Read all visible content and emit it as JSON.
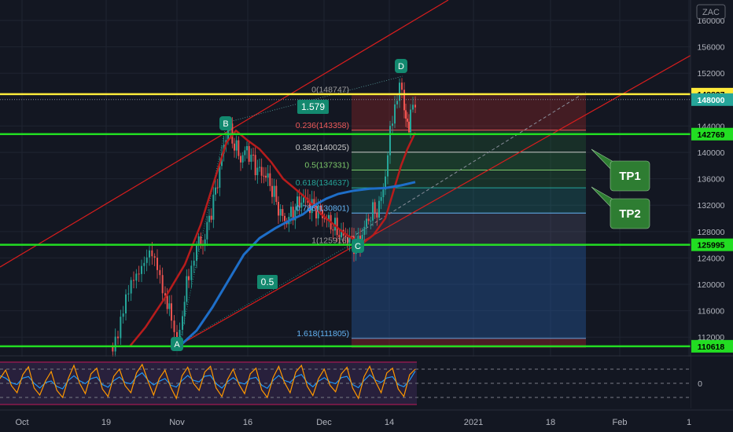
{
  "symbol": "ZAC",
  "colors": {
    "background": "#131722",
    "grid": "#1f2431",
    "axis_text": "#b2b5be",
    "candle_up": "#26a69a",
    "candle_down": "#ef5350",
    "ma_fast": "#b71c1c",
    "ma_slow": "#1e6ec8",
    "channel": "#d81d1d",
    "level_yellow": "#ffeb3b",
    "level_green": "#22dd22",
    "wave_label": "#13896f",
    "tp_box": "#2e7d32"
  },
  "chart_data": {
    "type": "candlestick",
    "x_ticks": [
      "Oct",
      "19",
      "Nov",
      "16",
      "Dec",
      "14",
      "2021",
      "18",
      "Feb",
      "1"
    ],
    "y_ticks": [
      112000,
      116000,
      120000,
      124000,
      128000,
      132000,
      136000,
      140000,
      144000,
      152000,
      156000,
      160000
    ],
    "ylim": [
      110000,
      162000
    ],
    "price_tags": [
      {
        "value": 148827,
        "label": "148827",
        "style": "yellow"
      },
      {
        "value": 148000,
        "label": "148000",
        "style": "teal"
      },
      {
        "value": 142769,
        "label": "142769",
        "style": "green"
      },
      {
        "value": 125995,
        "label": "125995",
        "style": "green"
      },
      {
        "value": 110618,
        "label": "110618",
        "style": "green"
      }
    ],
    "horizontal_levels": [
      {
        "value": 148827,
        "color": "yellow"
      },
      {
        "value": 142769,
        "color": "green"
      },
      {
        "value": 125995,
        "color": "green"
      },
      {
        "value": 110618,
        "color": "green"
      }
    ],
    "fibonacci": [
      {
        "ratio": "0",
        "value": 148747,
        "label": "0(148747)",
        "color": "#9e9e9e"
      },
      {
        "ratio": "0.236",
        "value": 143358,
        "label": "0.236(143358)",
        "color": "#f05a5a"
      },
      {
        "ratio": "0.382",
        "value": 140025,
        "label": "0.382(140025)",
        "color": "#c8c8c8"
      },
      {
        "ratio": "0.5",
        "value": 137331,
        "label": "0.5(137331)",
        "color": "#7cc86a"
      },
      {
        "ratio": "0.618",
        "value": 134637,
        "label": "0.618(134637)",
        "color": "#26a69a"
      },
      {
        "ratio": "0.786",
        "value": 130801,
        "label": "0.786(130801)",
        "color": "#64b5f6"
      },
      {
        "ratio": "1",
        "value": 125916,
        "label": "1(125916)",
        "color": "#9e9e9e"
      },
      {
        "ratio": "1.618",
        "value": 111805,
        "label": "1.618(111805)",
        "color": "#64b5f6"
      }
    ],
    "wave_points": [
      {
        "label": "A",
        "value": 111400
      },
      {
        "label": "B",
        "value": 144300
      },
      {
        "label": "C",
        "value": 125600
      },
      {
        "label": "D",
        "value": 151300
      }
    ],
    "ratio_labels": [
      "1.579",
      "0.5"
    ],
    "targets": [
      "TP1",
      "TP2"
    ],
    "price_path": [
      [
        140,
        110600
      ],
      [
        150,
        113000
      ],
      [
        160,
        117000
      ],
      [
        170,
        121000
      ],
      [
        180,
        123500
      ],
      [
        190,
        124500
      ],
      [
        200,
        122000
      ],
      [
        210,
        118500
      ],
      [
        218,
        114500
      ],
      [
        225,
        112000
      ],
      [
        232,
        116000
      ],
      [
        240,
        121500
      ],
      [
        250,
        126500
      ],
      [
        258,
        126000
      ],
      [
        266,
        130000
      ],
      [
        274,
        134000
      ],
      [
        282,
        139500
      ],
      [
        290,
        143800
      ],
      [
        298,
        141200
      ],
      [
        306,
        139000
      ],
      [
        314,
        140500
      ],
      [
        322,
        138500
      ],
      [
        330,
        137000
      ],
      [
        338,
        136500
      ],
      [
        346,
        134500
      ],
      [
        354,
        131500
      ],
      [
        362,
        129500
      ],
      [
        370,
        130500
      ],
      [
        378,
        132000
      ],
      [
        386,
        133000
      ],
      [
        394,
        132000
      ],
      [
        402,
        131500
      ],
      [
        410,
        130500
      ],
      [
        418,
        129500
      ],
      [
        426,
        128500
      ],
      [
        434,
        127500
      ],
      [
        442,
        127000
      ],
      [
        450,
        126200
      ],
      [
        458,
        126500
      ],
      [
        466,
        129500
      ],
      [
        474,
        131000
      ],
      [
        482,
        131500
      ],
      [
        490,
        136500
      ],
      [
        496,
        142500
      ],
      [
        502,
        147500
      ],
      [
        508,
        150200
      ],
      [
        514,
        146500
      ],
      [
        518,
        143700
      ],
      [
        522,
        145500
      ],
      [
        528,
        148000
      ]
    ],
    "ma_fast_path": [
      [
        165,
        110600
      ],
      [
        185,
        113500
      ],
      [
        210,
        118000
      ],
      [
        235,
        123000
      ],
      [
        255,
        129000
      ],
      [
        272,
        135500
      ],
      [
        288,
        141500
      ],
      [
        300,
        143300
      ],
      [
        315,
        141800
      ],
      [
        330,
        140500
      ],
      [
        345,
        138500
      ],
      [
        360,
        136000
      ],
      [
        375,
        134500
      ],
      [
        390,
        133000
      ],
      [
        405,
        131000
      ],
      [
        420,
        129500
      ],
      [
        435,
        128000
      ],
      [
        450,
        126800
      ],
      [
        462,
        126300
      ],
      [
        475,
        127500
      ],
      [
        490,
        130000
      ],
      [
        500,
        134000
      ],
      [
        510,
        138000
      ],
      [
        518,
        140500
      ],
      [
        528,
        143000
      ]
    ],
    "ma_slow_path": [
      [
        228,
        110600
      ],
      [
        250,
        113000
      ],
      [
        270,
        116500
      ],
      [
        290,
        120500
      ],
      [
        310,
        124500
      ],
      [
        330,
        127000
      ],
      [
        350,
        128500
      ],
      [
        370,
        129800
      ],
      [
        385,
        130600
      ],
      [
        400,
        132000
      ],
      [
        415,
        133000
      ],
      [
        430,
        133700
      ],
      [
        450,
        134200
      ],
      [
        470,
        134500
      ],
      [
        490,
        134600
      ],
      [
        510,
        135000
      ],
      [
        528,
        135500
      ]
    ],
    "oscillator_levels": [
      80,
      50,
      20
    ],
    "oscillator_ticks": [
      "0"
    ]
  },
  "oscillator": {
    "series_a": [
      60,
      78,
      45,
      30,
      68,
      85,
      40,
      25,
      55,
      75,
      35,
      20,
      60,
      88,
      50,
      28,
      70,
      82,
      38,
      22,
      65,
      80,
      45,
      30,
      72,
      90,
      55,
      25,
      60,
      78,
      42,
      18,
      66,
      84,
      50,
      35,
      74,
      86,
      40,
      22,
      58,
      80,
      48,
      28,
      70,
      82,
      36,
      20,
      62,
      86,
      52,
      30,
      74,
      88,
      44,
      24,
      60,
      80,
      46,
      32,
      70,
      84,
      40,
      18,
      64,
      86,
      54,
      30,
      72,
      82,
      38,
      22,
      68,
      80
    ]
  }
}
